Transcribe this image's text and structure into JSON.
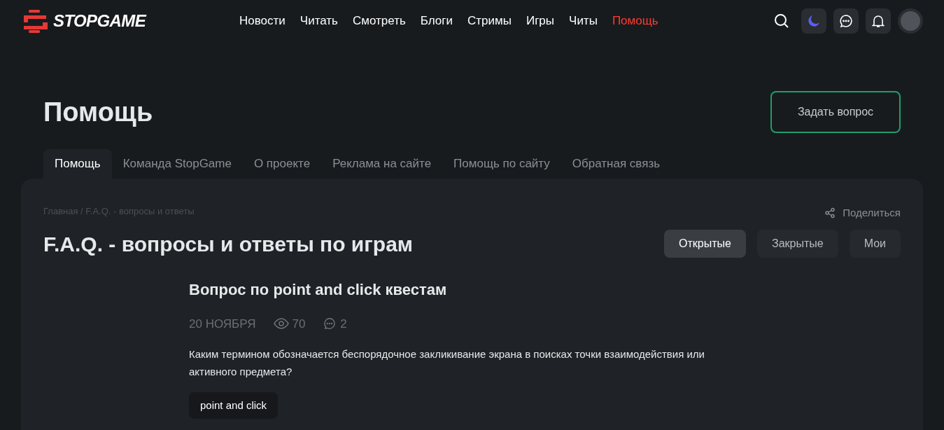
{
  "logo": {
    "text": "STOPGAME"
  },
  "nav": [
    {
      "label": "Новости",
      "selected": false
    },
    {
      "label": "Читать",
      "selected": false
    },
    {
      "label": "Смотреть",
      "selected": false
    },
    {
      "label": "Блоги",
      "selected": false
    },
    {
      "label": "Стримы",
      "selected": false
    },
    {
      "label": "Игры",
      "selected": false
    },
    {
      "label": "Читы",
      "selected": false
    },
    {
      "label": "Помощь",
      "selected": true
    }
  ],
  "page_title": "Помощь",
  "ask_button": "Задать вопрос",
  "tabs": [
    {
      "label": "Помощь",
      "selected": true
    },
    {
      "label": "Команда StopGame",
      "selected": false
    },
    {
      "label": "О проекте",
      "selected": false
    },
    {
      "label": "Реклама на сайте",
      "selected": false
    },
    {
      "label": "Помощь по сайту",
      "selected": false
    },
    {
      "label": "Обратная связь",
      "selected": false
    }
  ],
  "breadcrumb": "Главная / F.A.Q. - вопросы и ответы",
  "share": "Поделиться",
  "section_title": "F.A.Q. - вопросы и ответы по играм",
  "filters": [
    {
      "label": "Открытые",
      "selected": true
    },
    {
      "label": "Закрытые",
      "selected": false
    },
    {
      "label": "Мои",
      "selected": false
    }
  ],
  "question": {
    "title": "Вопрос по point and click квестам",
    "date": "20 НОЯБРЯ",
    "views": "70",
    "comments": "2",
    "text": "Каким термином обозначается беспорядочное закликивание экрана в поисках точки взаимодействия или активного предмета?",
    "tags": [
      "point and click"
    ]
  }
}
